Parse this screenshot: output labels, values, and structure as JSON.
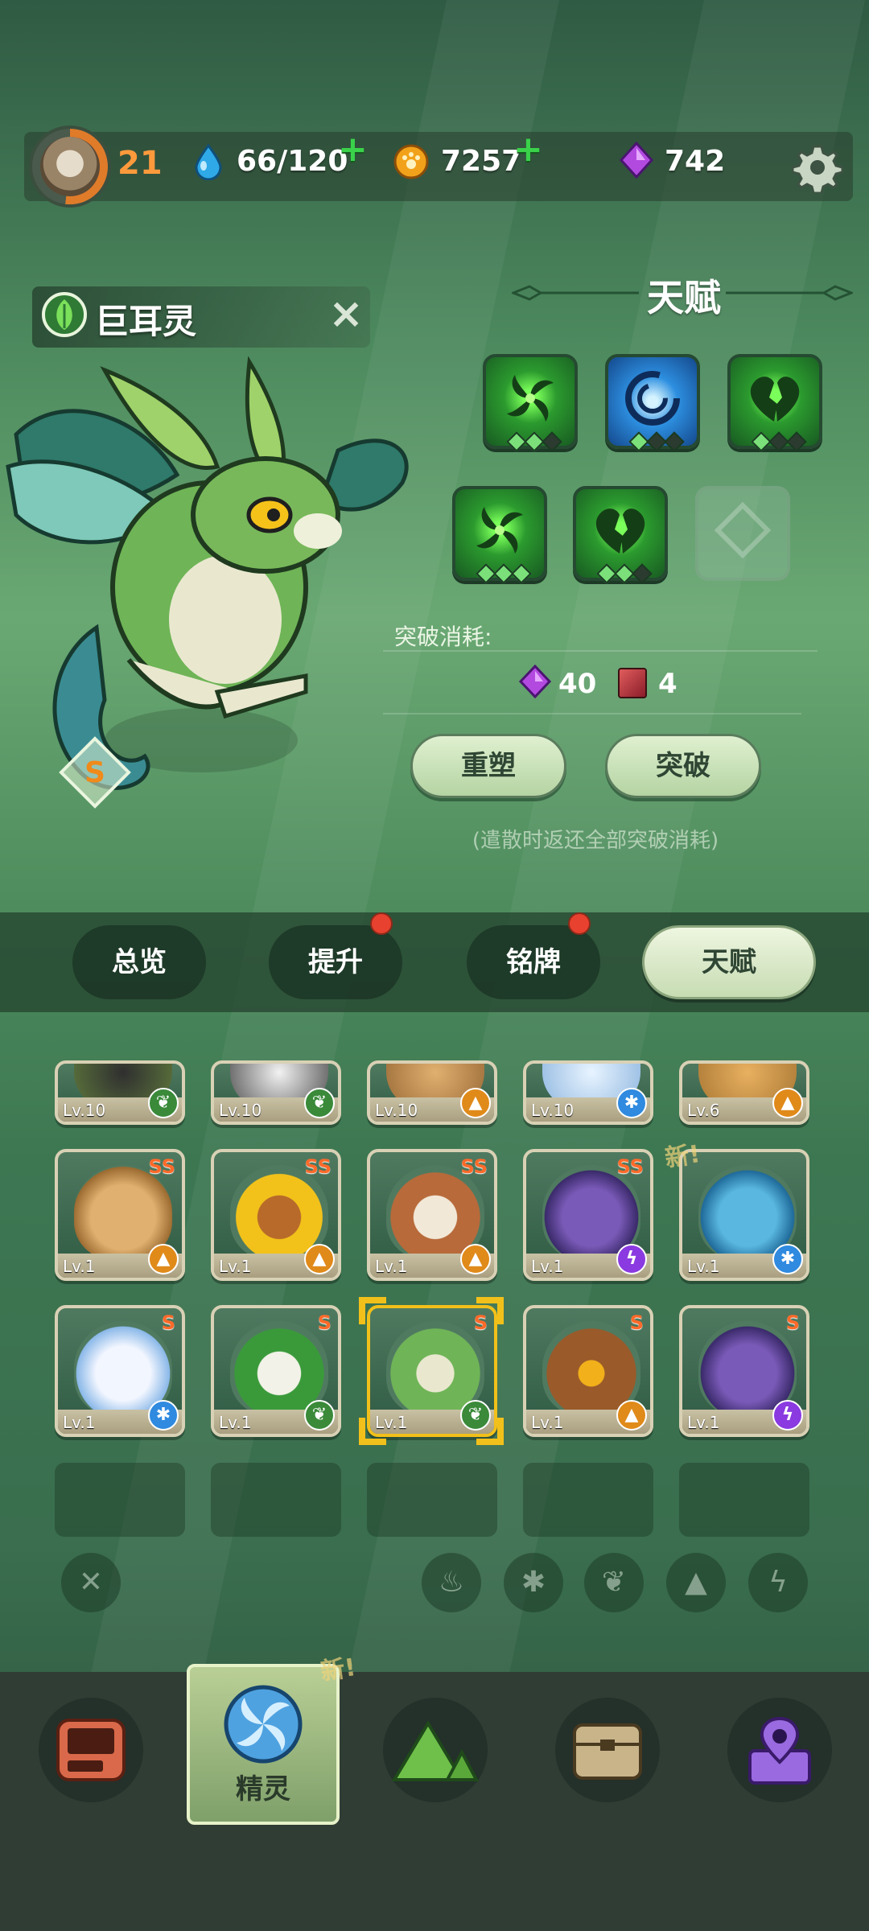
{
  "header": {
    "player_level": "21",
    "water": "66/120",
    "coins": "7257",
    "gems": "742"
  },
  "pet": {
    "name": "巨耳灵",
    "rank": "S"
  },
  "talent": {
    "title": "天赋",
    "cost_label": "突破消耗:",
    "cost_gems": "40",
    "cost_books": "4",
    "reshape_label": "重塑",
    "breakthrough_label": "突破",
    "note": "(遣散时返还全部突破消耗)"
  },
  "tabs": [
    {
      "label": "总览"
    },
    {
      "label": "提升"
    },
    {
      "label": "铭牌"
    },
    {
      "label": "天赋"
    }
  ],
  "grid": {
    "row0": [
      {
        "lv": "Lv.10"
      },
      {
        "lv": "Lv.10"
      },
      {
        "lv": "Lv.10"
      },
      {
        "lv": "Lv.10"
      },
      {
        "lv": "Lv.6"
      }
    ],
    "row1": [
      {
        "lv": "Lv.1",
        "grade": "SS"
      },
      {
        "lv": "Lv.1",
        "grade": "SS"
      },
      {
        "lv": "Lv.1",
        "grade": "SS"
      },
      {
        "lv": "Lv.1",
        "grade": "SS"
      },
      {
        "lv": "Lv.1",
        "grade": ""
      }
    ],
    "row2": [
      {
        "lv": "Lv.1",
        "grade": "S"
      },
      {
        "lv": "Lv.1",
        "grade": "S"
      },
      {
        "lv": "Lv.1",
        "grade": "S"
      },
      {
        "lv": "Lv.1",
        "grade": "S"
      },
      {
        "lv": "Lv.1",
        "grade": "S"
      }
    ],
    "new_tag": "新!"
  },
  "bottom_nav": {
    "active_label": "精灵",
    "new_tag": "新!"
  },
  "colors": {
    "accent_green": "#3ad24b",
    "level_orange": "#ff9a3c",
    "grade_orange": "#ff6a2a",
    "alert_red": "#e8412f"
  }
}
